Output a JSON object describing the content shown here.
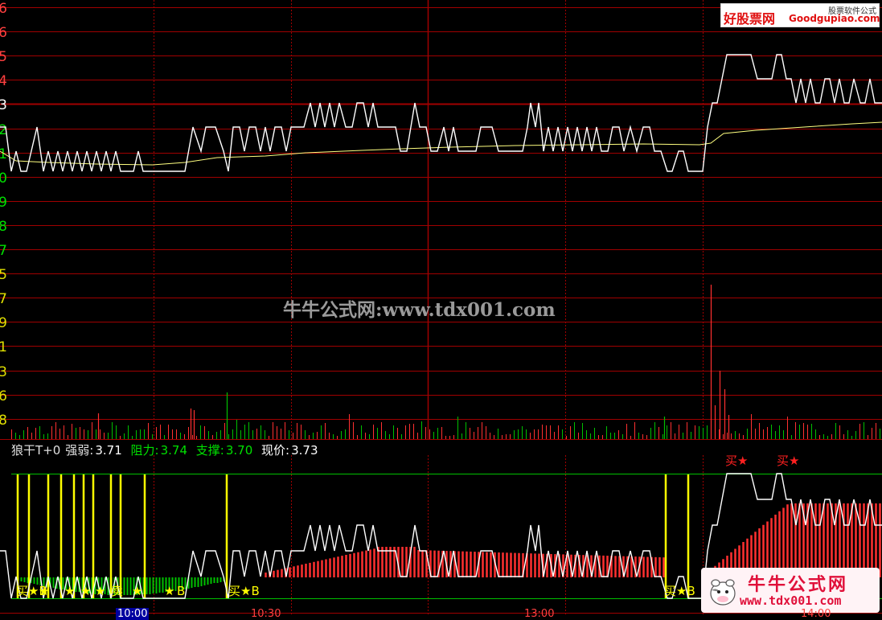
{
  "app": {
    "indicator_name": "狼干T+0",
    "strength_label": "强弱:",
    "strength_value": "3.71",
    "resistance_label": "阻力:",
    "resistance_value": "3.74",
    "support_label": "支撑:",
    "support_value": "3.70",
    "price_label": "现价:",
    "price_value": "3.73"
  },
  "axis_labels": [
    {
      "text": "6",
      "color": "#ff4040"
    },
    {
      "text": "6",
      "color": "#ff4040"
    },
    {
      "text": "5",
      "color": "#ff4040"
    },
    {
      "text": "4",
      "color": "#ff4040"
    },
    {
      "text": "3",
      "color": "#ffffff"
    },
    {
      "text": "2",
      "color": "#00e000"
    },
    {
      "text": "1",
      "color": "#00e000"
    },
    {
      "text": "0",
      "color": "#00e000"
    },
    {
      "text": "9",
      "color": "#00e000"
    },
    {
      "text": "8",
      "color": "#00e000"
    },
    {
      "text": "7",
      "color": "#00e000"
    },
    {
      "text": "5",
      "color": "#e0e000"
    },
    {
      "text": "7",
      "color": "#e0e000"
    },
    {
      "text": "9",
      "color": "#e0e000"
    },
    {
      "text": "1",
      "color": "#e0e000"
    },
    {
      "text": "3",
      "color": "#e0e000"
    },
    {
      "text": "6",
      "color": "#e0e000"
    },
    {
      "text": "8",
      "color": "#e0e000"
    }
  ],
  "watermark": "牛牛公式网:www.tdx001.com",
  "logo_top": {
    "brand": "好股票网",
    "domain": "Goodgupiao.com",
    "sub": "股票软件公式"
  },
  "logo_bottom": {
    "line1": "牛牛公式网",
    "line2": "www.tdx001.com"
  },
  "signals": {
    "buy_star_top": "买★",
    "buy_star_b": "买★B",
    "sell_text": "卖",
    "star": "★",
    "b_text": "B"
  },
  "time_labels": [
    "10:00",
    "10:30",
    "13:00",
    "14:00"
  ],
  "colors": {
    "grid_red": "#a00000",
    "grid_blue": "#2020a0",
    "price_white": "#ffffff",
    "avg_yellow": "#ffff80",
    "volume_green": "#00c000",
    "volume_red": "#ff3030",
    "signal_yellow": "#ffff00",
    "bottom_green": "#00c000"
  }
}
